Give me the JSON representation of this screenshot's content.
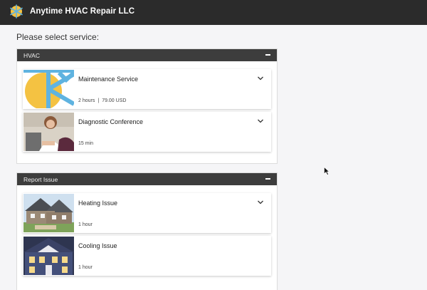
{
  "app": {
    "title": "Anytime HVAC Repair LLC"
  },
  "prompt": "Please select service:",
  "icons": {
    "logo": "snowflake-sun-logo",
    "collapse": "minus-icon",
    "expand": "chevron-down-icon"
  },
  "colors": {
    "topbar": "#2b2b2b",
    "header": "#3d3d3d",
    "logo_sun": "#f4c242",
    "logo_snow": "#5fb3e0"
  },
  "sections": [
    {
      "title": "HVAC",
      "services": [
        {
          "name": "Maintenance Service",
          "duration": "2 hours",
          "price": "79.00 USD",
          "thumb": "hvac-logo-image",
          "expandable": true
        },
        {
          "name": "Diagnostic Conference",
          "duration": "15 min",
          "thumb": "woman-laptop-photo",
          "expandable": true
        }
      ]
    },
    {
      "title": "Report Issue",
      "services": [
        {
          "name": "Heating Issue",
          "duration": "1 hour",
          "thumb": "stone-house-photo",
          "expandable": true
        },
        {
          "name": "Cooling Issue",
          "duration": "1 hour",
          "thumb": "blue-house-photo",
          "expandable": false
        }
      ]
    }
  ]
}
